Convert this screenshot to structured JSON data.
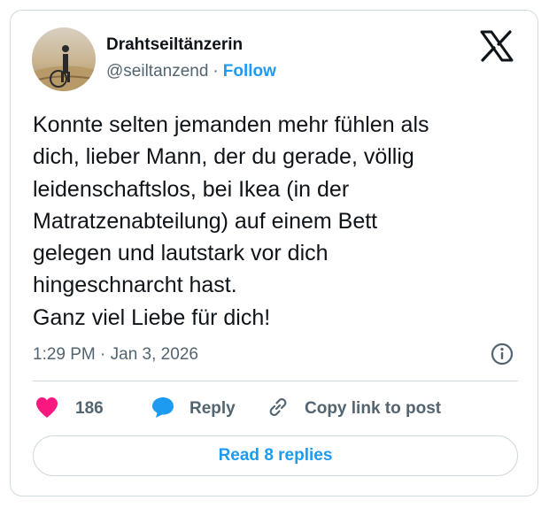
{
  "author": {
    "display_name": "Drahtseiltänzerin",
    "handle": "@seiltanzend",
    "separator": "·",
    "follow_label": "Follow"
  },
  "tweet": {
    "lines": [
      "Konnte selten jemanden mehr fühlen als",
      "dich, lieber Mann, der du gerade, völlig",
      "leidenschaftslos, bei Ikea (in der",
      "Matratzenabteilung) auf einem Bett",
      "gelegen und lautstark vor dich",
      "hingeschnarcht hast.",
      "Ganz viel Liebe für dich!"
    ],
    "timestamp": "1:29 PM · Jan 3, 2026"
  },
  "actions": {
    "like_count": "186",
    "reply_label": "Reply",
    "copy_label": "Copy link to post"
  },
  "read_replies_label": "Read 8 replies",
  "colors": {
    "accent": "#1d9bf0",
    "like": "#f91880",
    "text": "#0f1419",
    "muted": "#536471",
    "border": "#cfd9de"
  },
  "icons": [
    "x-logo-icon",
    "info-icon",
    "heart-icon",
    "reply-bubble-icon",
    "link-icon"
  ]
}
